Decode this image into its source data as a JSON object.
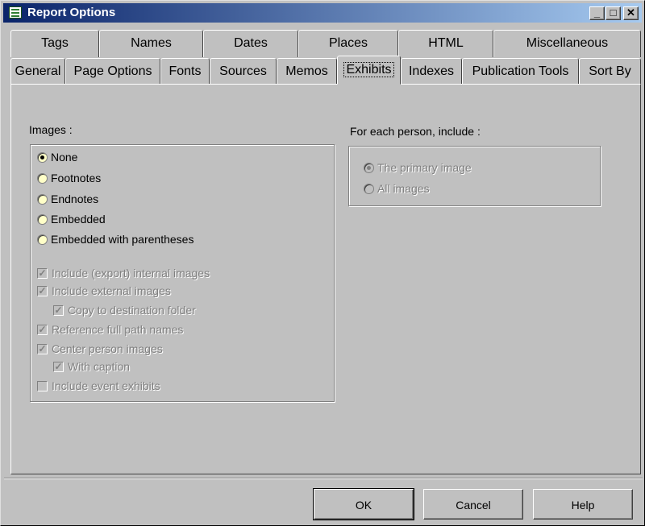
{
  "window": {
    "title": "Report Options",
    "controls": {
      "minimize": "_",
      "maximize": "□",
      "close": "✕"
    }
  },
  "tabs_row1": [
    {
      "label": "Tags"
    },
    {
      "label": "Names"
    },
    {
      "label": "Dates"
    },
    {
      "label": "Places"
    },
    {
      "label": "HTML"
    },
    {
      "label": "Miscellaneous"
    }
  ],
  "tabs_row2": [
    {
      "label": "General"
    },
    {
      "label": "Page Options"
    },
    {
      "label": "Fonts"
    },
    {
      "label": "Sources"
    },
    {
      "label": "Memos"
    },
    {
      "label": "Exhibits",
      "active": true
    },
    {
      "label": "Indexes"
    },
    {
      "label": "Publication Tools"
    },
    {
      "label": "Sort By"
    }
  ],
  "images": {
    "label": "Images :",
    "radios": [
      {
        "label": "None",
        "selected": true
      },
      {
        "label": "Footnotes",
        "selected": false
      },
      {
        "label": "Endnotes",
        "selected": false
      },
      {
        "label": "Embedded",
        "selected": false
      },
      {
        "label": "Embedded with parentheses",
        "selected": false
      }
    ],
    "checkboxes": [
      {
        "label": "Include (export) internal images",
        "checked": true,
        "enabled": false
      },
      {
        "label": "Include external images",
        "checked": true,
        "enabled": false
      },
      {
        "label": "Copy to destination folder",
        "checked": true,
        "enabled": false
      },
      {
        "label": "Reference full path names",
        "checked": true,
        "enabled": false
      },
      {
        "label": "Center person images",
        "checked": true,
        "enabled": false
      },
      {
        "label": "With caption",
        "checked": true,
        "enabled": false
      },
      {
        "label": "Include event exhibits",
        "checked": false,
        "enabled": false
      }
    ]
  },
  "per_person": {
    "label": "For each person, include :",
    "radios": [
      {
        "label": "The primary image",
        "selected": true,
        "enabled": false
      },
      {
        "label": "All images",
        "selected": false,
        "enabled": false
      }
    ]
  },
  "buttons": {
    "ok": "OK",
    "cancel": "Cancel",
    "help": "Help"
  },
  "colors": {
    "face": "#c0c0c0",
    "titlebar_start": "#0a246a",
    "titlebar_end": "#a6caf0",
    "radio_fill": "#ffffc8"
  }
}
